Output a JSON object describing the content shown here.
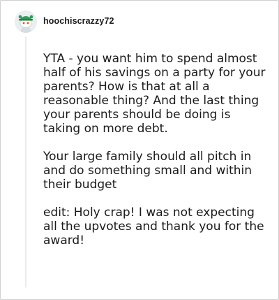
{
  "comment": {
    "username": "hoochiscrazzy72",
    "avatar_icon": "snoo-avatar-icon",
    "paragraphs": [
      "YTA - you want him to spend almost half of his savings on a party for your parents? How is that at all a reasonable thing? And the last thing your parents should be doing is taking on more debt.",
      "Your large family should all pitch in and do something small and within their budget",
      "edit: Holy crap! I was not expecting all the upvotes and thank you for the award!"
    ]
  },
  "colors": {
    "avatar_hat": "#2e9d5a",
    "text": "#1a1a1b"
  }
}
